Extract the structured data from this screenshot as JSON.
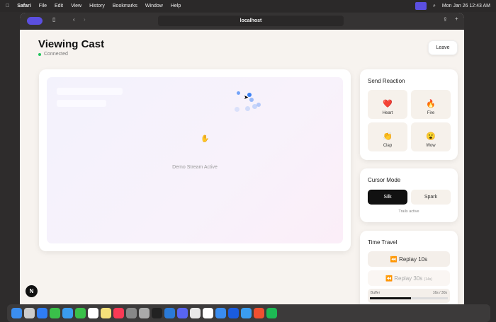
{
  "menubar": {
    "app": "Safari",
    "items": [
      "File",
      "Edit",
      "View",
      "History",
      "Bookmarks",
      "Window",
      "Help"
    ],
    "clock": "Mon Jan 26  12:43 AM"
  },
  "browser": {
    "url": "localhost"
  },
  "page": {
    "title": "Viewing Cast",
    "status": "Connected",
    "leave": "Leave",
    "stream_text": "Demo Stream Active"
  },
  "reactions": {
    "title": "Send Reaction",
    "items": [
      {
        "emoji": "❤️",
        "label": "Heart"
      },
      {
        "emoji": "🔥",
        "label": "Fire"
      },
      {
        "emoji": "👏",
        "label": "Clap"
      },
      {
        "emoji": "😮",
        "label": "Wow"
      }
    ]
  },
  "cursor_mode": {
    "title": "Cursor Mode",
    "options": [
      "Silk",
      "Spark"
    ],
    "selected": "Silk",
    "note": "Trails active"
  },
  "time_travel": {
    "title": "Time Travel",
    "replay10": "⏪ Replay 10s",
    "replay30": "⏪ Replay 30s",
    "replay30_note": "(14s)",
    "buffer_label": "Buffer",
    "buffer_value": "16s / 30s",
    "buffer_fraction": 0.53
  },
  "nextjs_badge": "N",
  "colors": {
    "accent": "#5b4fe0",
    "connected": "#22c55e",
    "trail": "#3b82f6"
  }
}
